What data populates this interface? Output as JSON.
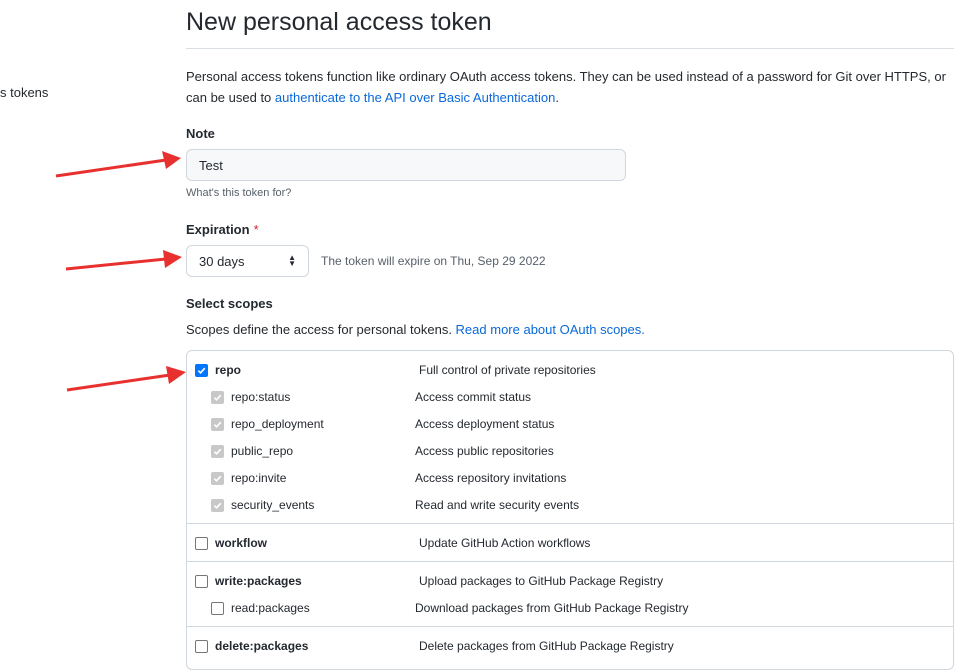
{
  "sidebar": {
    "fragment_text": "s tokens"
  },
  "header": {
    "title": "New personal access token"
  },
  "intro": {
    "text": "Personal access tokens function like ordinary OAuth access tokens. They can be used instead of a password for Git over HTTPS, or can be used to ",
    "link_text": "authenticate to the API over Basic Authentication",
    "suffix": "."
  },
  "note": {
    "label": "Note",
    "value": "Test",
    "hint": "What's this token for?"
  },
  "expiration": {
    "label": "Expiration",
    "required_mark": "*",
    "selected": "30 days",
    "note": "The token will expire on Thu, Sep 29 2022"
  },
  "scopes": {
    "label": "Select scopes",
    "description": "Scopes define the access for personal tokens. ",
    "link_text": "Read more about OAuth scopes.",
    "groups": [
      {
        "name": "repo",
        "description": "Full control of private repositories",
        "checked": true,
        "children": [
          {
            "name": "repo:status",
            "description": "Access commit status",
            "checked": true,
            "disabled": true
          },
          {
            "name": "repo_deployment",
            "description": "Access deployment status",
            "checked": true,
            "disabled": true
          },
          {
            "name": "public_repo",
            "description": "Access public repositories",
            "checked": true,
            "disabled": true
          },
          {
            "name": "repo:invite",
            "description": "Access repository invitations",
            "checked": true,
            "disabled": true
          },
          {
            "name": "security_events",
            "description": "Read and write security events",
            "checked": true,
            "disabled": true
          }
        ]
      },
      {
        "name": "workflow",
        "description": "Update GitHub Action workflows",
        "checked": false,
        "children": []
      },
      {
        "name": "write:packages",
        "description": "Upload packages to GitHub Package Registry",
        "checked": false,
        "children": [
          {
            "name": "read:packages",
            "description": "Download packages from GitHub Package Registry",
            "checked": false,
            "disabled": false
          }
        ]
      },
      {
        "name": "delete:packages",
        "description": "Delete packages from GitHub Package Registry",
        "checked": false,
        "children": []
      }
    ]
  },
  "colors": {
    "link": "#0969da",
    "required": "#cf222e",
    "checkbox": "#0075ff",
    "annotation_arrow": "#e8312f"
  },
  "annotations": {
    "arrow_icon": "red-arrow-icon",
    "count": 3
  }
}
